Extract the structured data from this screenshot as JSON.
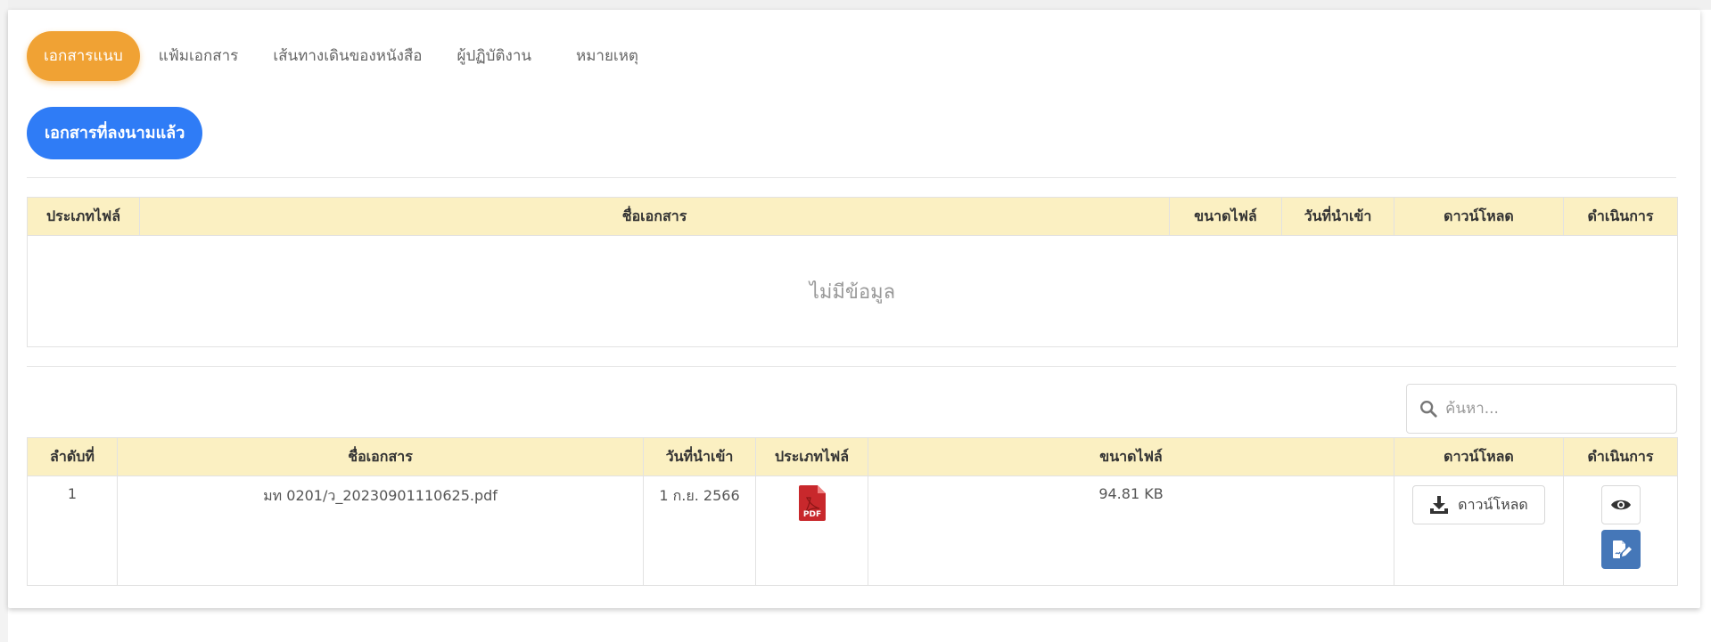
{
  "tabs": [
    {
      "label": "เอกสารแนบ",
      "active": true
    },
    {
      "label": "แฟ้มเอกสาร",
      "active": false
    },
    {
      "label": "เส้นทางเดินของหนังสือ",
      "active": false
    },
    {
      "label": "ผู้ปฏิบัติงาน",
      "active": false
    },
    {
      "label": "หมายเหตุ",
      "active": false
    }
  ],
  "signed_button_label": "เอกสารที่ลงนามแล้ว",
  "signed_table": {
    "headers": [
      "ประเภทไฟล์",
      "ชื่อเอกสาร",
      "ขนาดไฟล์",
      "วันที่นำเข้า",
      "ดาวน์โหลด",
      "ดำเนินการ"
    ],
    "empty_text": "ไม่มีข้อมูล"
  },
  "search": {
    "placeholder": "ค้นหา..."
  },
  "attachments_table": {
    "headers": [
      "ลำดับที่",
      "ชื่อเอกสาร",
      "วันที่นำเข้า",
      "ประเภทไฟล์",
      "ขนาดไฟล์",
      "ดาวน์โหลด",
      "ดำเนินการ"
    ],
    "rows": [
      {
        "index": "1",
        "name": "มท 0201/ว_20230901110625.pdf",
        "date": "1 ก.ย. 2566",
        "file_type": "PDF",
        "size": "94.81 KB",
        "download_label": "ดาวน์โหลด"
      }
    ]
  },
  "colors": {
    "tab_active": "#f0a234",
    "primary_button": "#2f7cf6",
    "header_bg": "#fbf0c2",
    "edit_button": "#4577b8",
    "pdf_red": "#c8282c"
  },
  "icons": [
    "search-icon",
    "pdf-file-icon",
    "download-icon",
    "eye-icon",
    "edit-document-icon"
  ]
}
